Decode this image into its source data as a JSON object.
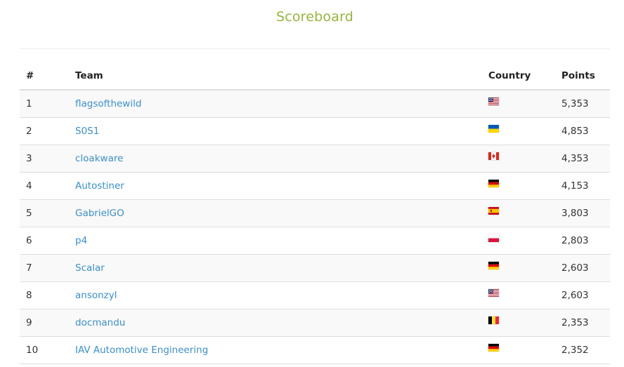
{
  "title": "Scoreboard",
  "columns": {
    "rank": "#",
    "team": "Team",
    "country": "Country",
    "points": "Points"
  },
  "rows": [
    {
      "rank": "1",
      "team": "flagsofthewild",
      "country": "us-flag-icon",
      "points": "5,353"
    },
    {
      "rank": "2",
      "team": "S0S1",
      "country": "ua-flag-icon",
      "points": "4,853"
    },
    {
      "rank": "3",
      "team": "cloakware",
      "country": "ca-flag-icon",
      "points": "4,353"
    },
    {
      "rank": "4",
      "team": "Autostiner",
      "country": "de-flag-icon",
      "points": "4,153"
    },
    {
      "rank": "5",
      "team": "GabrielGO",
      "country": "es-flag-icon",
      "points": "3,803"
    },
    {
      "rank": "6",
      "team": "p4",
      "country": "pl-flag-icon",
      "points": "2,803"
    },
    {
      "rank": "7",
      "team": "Scalar",
      "country": "de-flag-icon",
      "points": "2,603"
    },
    {
      "rank": "8",
      "team": "ansonzyl",
      "country": "us-flag-icon",
      "points": "2,603"
    },
    {
      "rank": "9",
      "team": "docmandu",
      "country": "be-flag-icon",
      "points": "2,353"
    },
    {
      "rank": "10",
      "team": "IAV Automotive Engineering",
      "country": "de-flag-icon",
      "points": "2,352"
    }
  ],
  "colors": {
    "title": "#95b53c",
    "link": "#3b8fc6",
    "stripe": "#f9f9f9",
    "border": "#dddddd"
  }
}
